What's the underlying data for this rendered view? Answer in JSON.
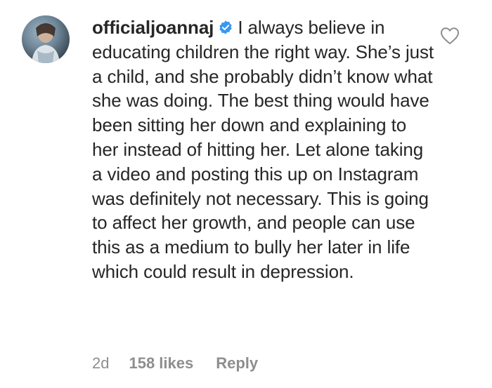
{
  "comment": {
    "username": "officialjoannaj",
    "verified": true,
    "text": "I always believe in educating children the right way. She’s just a child, and she probably didn’t know what she was doing. The best thing would have been sitting her down and explaining to her instead of hitting her. Let alone taking a video and posting this up on Instagram was definitely not necessary. This is going to affect her growth, and people can use this as a medium to bully her later in life which could result in depression.",
    "time": "2d",
    "likes": "158 likes",
    "reply_label": "Reply"
  },
  "icons": {
    "verified": "verified-badge-icon",
    "like": "heart-outline-icon"
  },
  "colors": {
    "text": "#262626",
    "muted": "#8e8e8e",
    "verified": "#3897f0"
  }
}
